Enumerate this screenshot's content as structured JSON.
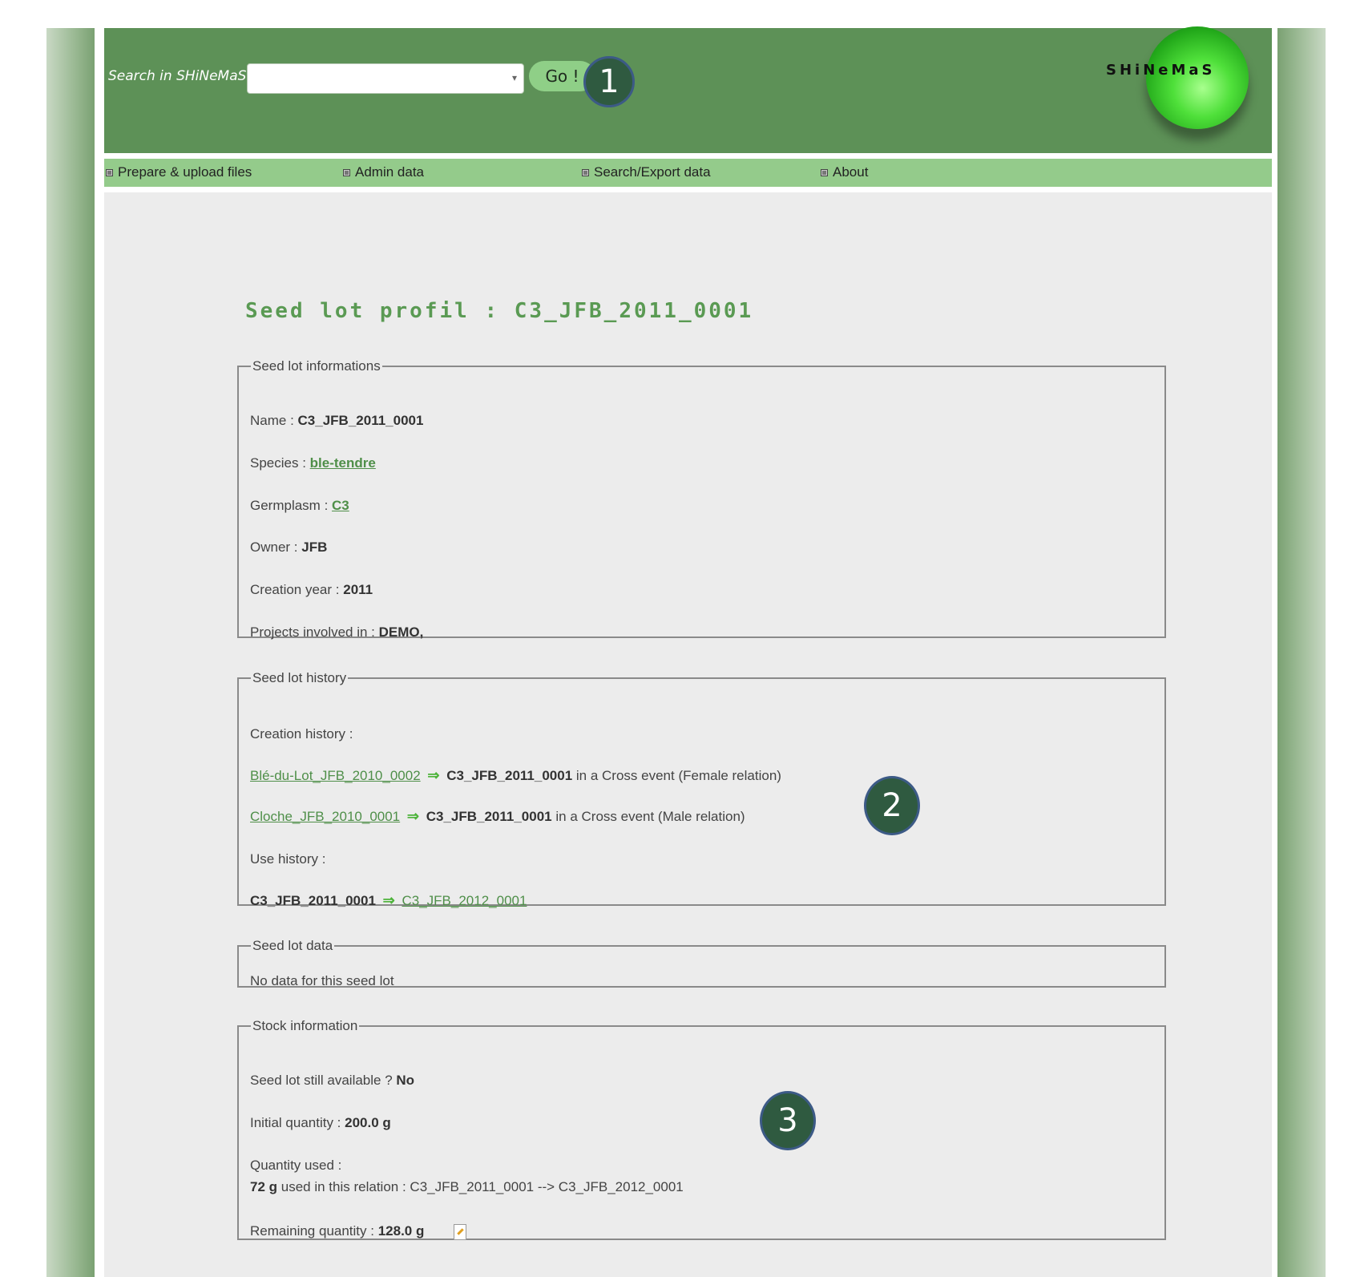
{
  "header": {
    "search_label": "Search in SHiNeMaS :",
    "search_value": "",
    "go_label": "Go !",
    "logo_text": "SHiNeMaS"
  },
  "badges": [
    "1",
    "2",
    "3"
  ],
  "nav": {
    "items": [
      {
        "label": "Prepare & upload files"
      },
      {
        "label": "Admin data"
      },
      {
        "label": "Search/Export data"
      },
      {
        "label": "About"
      }
    ]
  },
  "page": {
    "title": "Seed lot profil : C3_JFB_2011_0001"
  },
  "info": {
    "legend": "Seed lot informations",
    "name_label": "Name :",
    "name_value": "C3_JFB_2011_0001",
    "species_label": "Species :",
    "species_value": "ble-tendre",
    "germplasm_label": "Germplasm :",
    "germplasm_value": "C3",
    "owner_label": "Owner :",
    "owner_value": "JFB",
    "year_label": "Creation year :",
    "year_value": "2011",
    "projects_label": "Projects involved in :",
    "projects_value": "DEMO,"
  },
  "history": {
    "legend": "Seed lot history",
    "creation_label": "Creation history :",
    "creation_rows": [
      {
        "source": "Blé-du-Lot_JFB_2010_0002",
        "target": "C3_JFB_2011_0001",
        "text": "in a Cross event (Female relation)"
      },
      {
        "source": "Cloche_JFB_2010_0001",
        "target": "C3_JFB_2011_0001",
        "text": "in a Cross event (Male relation)"
      }
    ],
    "use_label": "Use history :",
    "use_rows": [
      {
        "source": "C3_JFB_2011_0001",
        "target": "C3_JFB_2012_0001"
      }
    ]
  },
  "data_section": {
    "legend": "Seed lot data",
    "empty_text": "No data for this seed lot"
  },
  "stock": {
    "legend": "Stock information",
    "available_label": "Seed lot still available ?",
    "available_value": "No",
    "initial_label": "Initial quantity :",
    "initial_value": "200.0 g",
    "used_label": "Quantity used :",
    "used_amount": "72 g",
    "used_text": "used in this relation : C3_JFB_2011_0001 --> C3_JFB_2012_0001",
    "remaining_label": "Remaining quantity :",
    "remaining_value": "128.0 g"
  },
  "icons": {
    "arrow": "⇒",
    "dropdown": "▾",
    "edit": "edit-icon"
  }
}
